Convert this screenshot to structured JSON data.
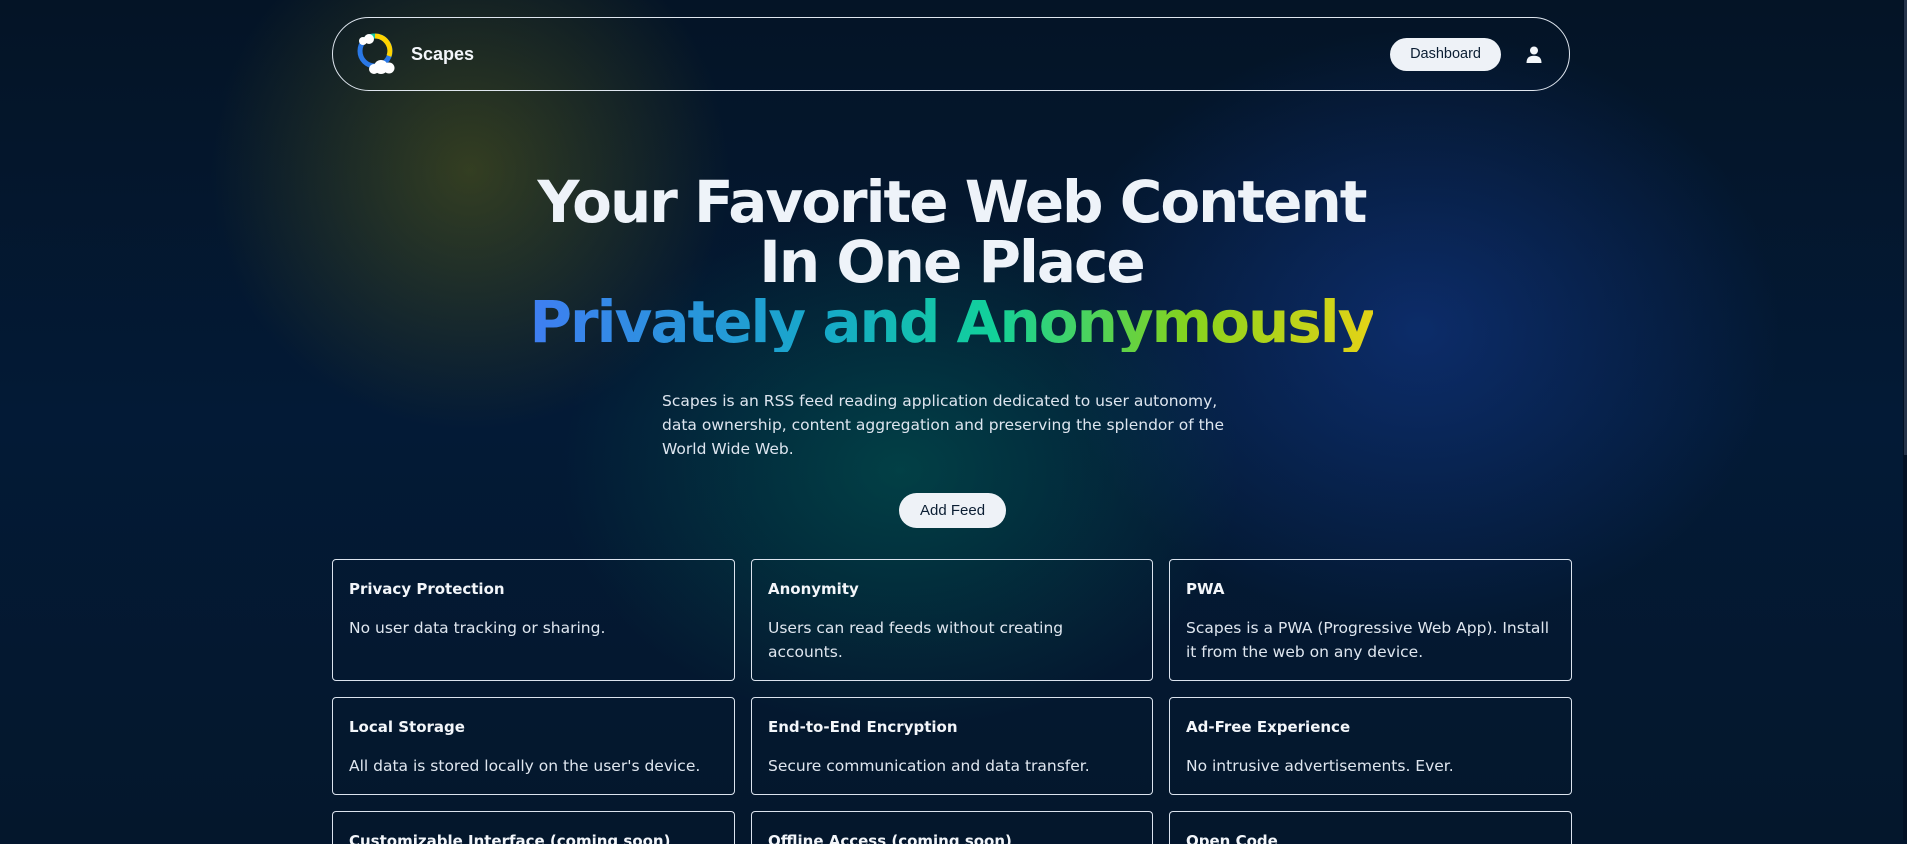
{
  "nav": {
    "brand": "Scapes",
    "dashboard_label": "Dashboard",
    "logo_icon": "scapes-logo",
    "user_icon": "user-icon"
  },
  "hero": {
    "line1": "Your Favorite Web Content",
    "line2": "In One Place",
    "line3": "Privately and Anonymously",
    "lead": "Scapes is an RSS feed reading application dedicated to user autonomy, data ownership, content aggregation and preserving the splendor of the World Wide Web.",
    "cta_label": "Add Feed"
  },
  "features": [
    {
      "title": "Privacy Protection",
      "text": "No user data tracking or sharing."
    },
    {
      "title": "Anonymity",
      "text": "Users can read feeds without creating accounts."
    },
    {
      "title": "PWA",
      "text": "Scapes is a PWA (Progressive Web App). Install it from the web on any device."
    },
    {
      "title": "Local Storage",
      "text": "All data is stored locally on the user's device."
    },
    {
      "title": "End-to-End Encryption",
      "text": "Secure communication and data transfer."
    },
    {
      "title": "Ad-Free Experience",
      "text": "No intrusive advertisements. Ever."
    },
    {
      "title": "Customizable Interface (coming soon)",
      "text": ""
    },
    {
      "title": "Offline Access (coming soon)",
      "text": ""
    },
    {
      "title": "Open Code",
      "text": ""
    }
  ],
  "colors": {
    "background": "#03162e",
    "gradient_start": "#3f7ef2",
    "gradient_mid": "#12d19a",
    "gradient_end": "#e4d316"
  }
}
